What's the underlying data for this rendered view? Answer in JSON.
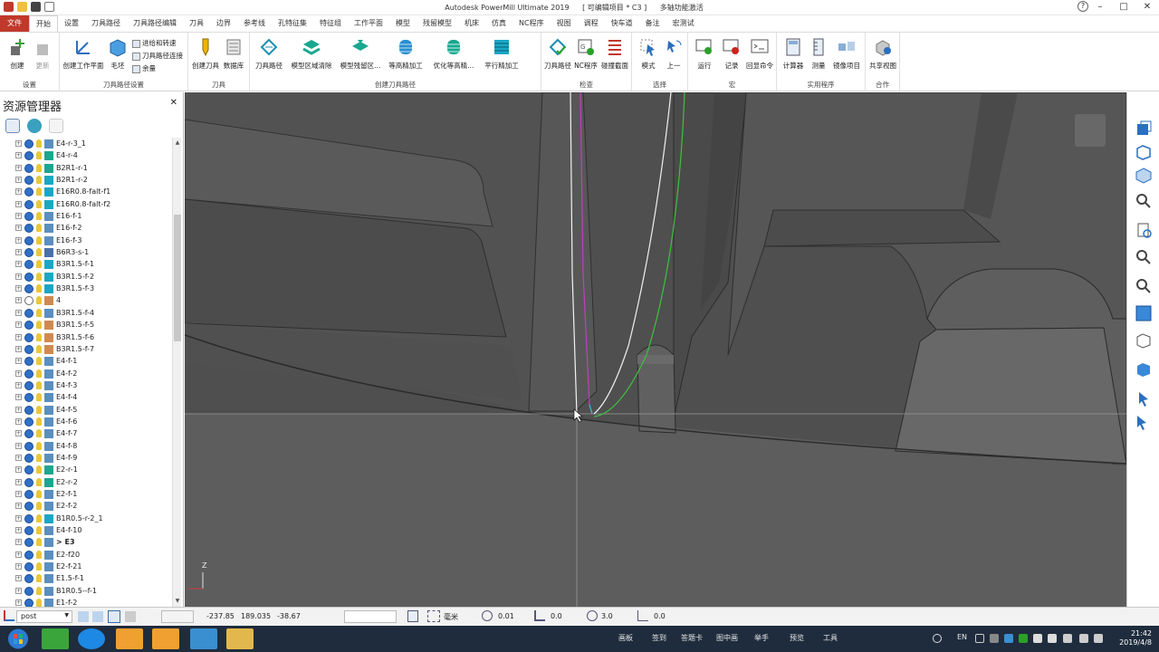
{
  "window": {
    "title": "Autodesk PowerMill Ultimate 2019",
    "project": "[ 可编辑项目 * C3 ]",
    "mode": "多轴功能激活"
  },
  "tabs": [
    "文件",
    "开始",
    "设置",
    "刀具路径",
    "刀具路径编辑",
    "刀具",
    "边界",
    "参考线",
    "孔特征集",
    "特征组",
    "工作平面",
    "模型",
    "残留模型",
    "机床",
    "仿真",
    "NC程序",
    "视图",
    "调程",
    "快车道",
    "备注",
    "宏测试"
  ],
  "ribbon": {
    "groups": {
      "setup": {
        "label": "设置",
        "buttons": [
          "创建",
          "更新"
        ]
      },
      "toolpath_setup": {
        "label": "刀具路径设置",
        "buttons": [
          "创建工作平面",
          "毛坯"
        ],
        "small": [
          "进给和转速",
          "刀具路径连接",
          "余量"
        ]
      },
      "tool": {
        "label": "刀具",
        "buttons": [
          "创建刀具",
          "数据库"
        ]
      },
      "create_toolpaths": {
        "label": "创建刀具路径",
        "buttons": [
          "刀具路径",
          "模型区域清除",
          "模型残留区...",
          "等高精加工",
          "优化等高精...",
          "平行精加工"
        ]
      },
      "verify": {
        "label": "检查",
        "buttons": [
          "刀具路径",
          "NC程序",
          "碰撞截面"
        ]
      },
      "select": {
        "label": "选择",
        "buttons": [
          "模式",
          "上一"
        ]
      },
      "macro": {
        "label": "宏",
        "buttons": [
          "运行",
          "记录",
          "回显命令"
        ]
      },
      "utilities": {
        "label": "实用程序",
        "buttons": [
          "计算器",
          "测量",
          "镜像项目"
        ]
      },
      "collab": {
        "label": "合作",
        "buttons": [
          "共享视图"
        ]
      }
    }
  },
  "explorer": {
    "title": "资源管理器",
    "items": [
      {
        "label": "E4-r-3_1",
        "checked": true,
        "icon": "parallel"
      },
      {
        "label": "E4-r-4",
        "checked": true,
        "icon": "clearance"
      },
      {
        "label": "B2R1-r-1",
        "checked": true,
        "icon": "clearance"
      },
      {
        "label": "B2R1-r-2",
        "checked": true,
        "icon": "waterline"
      },
      {
        "label": "E16R0.8-falt-f1",
        "checked": true,
        "icon": "waterline"
      },
      {
        "label": "E16R0.8-falt-f2",
        "checked": true,
        "icon": "waterline"
      },
      {
        "label": "E16-f-1",
        "checked": true,
        "icon": "parallel"
      },
      {
        "label": "E16-f-2",
        "checked": true,
        "icon": "parallel"
      },
      {
        "label": "E16-f-3",
        "checked": true,
        "icon": "parallel"
      },
      {
        "label": "B6R3-s-1",
        "checked": true,
        "icon": "swarf"
      },
      {
        "label": "B3R1.5-f-1",
        "checked": true,
        "icon": "waterline"
      },
      {
        "label": "B3R1.5-f-2",
        "checked": true,
        "icon": "waterline"
      },
      {
        "label": "B3R1.5-f-3",
        "checked": true,
        "icon": "waterline"
      },
      {
        "label": "4",
        "checked": false,
        "icon": "other"
      },
      {
        "label": "B3R1.5-f-4",
        "checked": true,
        "icon": "parallel"
      },
      {
        "label": "B3R1.5-f-5",
        "checked": true,
        "icon": "other"
      },
      {
        "label": "B3R1.5-f-6",
        "checked": true,
        "icon": "other"
      },
      {
        "label": "B3R1.5-f-7",
        "checked": true,
        "icon": "other"
      },
      {
        "label": "E4-f-1",
        "checked": true,
        "icon": "parallel"
      },
      {
        "label": "E4-f-2",
        "checked": true,
        "icon": "parallel"
      },
      {
        "label": "E4-f-3",
        "checked": true,
        "icon": "parallel"
      },
      {
        "label": "E4-f-4",
        "checked": true,
        "icon": "parallel"
      },
      {
        "label": "E4-f-5",
        "checked": true,
        "icon": "parallel"
      },
      {
        "label": "E4-f-6",
        "checked": true,
        "icon": "parallel"
      },
      {
        "label": "E4-f-7",
        "checked": true,
        "icon": "parallel"
      },
      {
        "label": "E4-f-8",
        "checked": true,
        "icon": "parallel"
      },
      {
        "label": "E4-f-9",
        "checked": true,
        "icon": "parallel"
      },
      {
        "label": "E2-r-1",
        "checked": true,
        "icon": "clearance"
      },
      {
        "label": "E2-r-2",
        "checked": true,
        "icon": "clearance"
      },
      {
        "label": "E2-f-1",
        "checked": true,
        "icon": "parallel"
      },
      {
        "label": "E2-f-2",
        "checked": true,
        "icon": "parallel"
      },
      {
        "label": "B1R0.5-r-2_1",
        "checked": true,
        "icon": "waterline"
      },
      {
        "label": "E4-f-10",
        "checked": true,
        "icon": "parallel"
      },
      {
        "label": "> E3",
        "checked": true,
        "icon": "parallel",
        "bold": true
      },
      {
        "label": "E2-f20",
        "checked": true,
        "icon": "parallel"
      },
      {
        "label": "E2-f-21",
        "checked": true,
        "icon": "parallel"
      },
      {
        "label": "E1.5-f-1",
        "checked": true,
        "icon": "parallel"
      },
      {
        "label": "B1R0.5--f-1",
        "checked": true,
        "icon": "parallel"
      },
      {
        "label": "E1-f-2",
        "checked": true,
        "icon": "parallel"
      }
    ]
  },
  "viewport": {
    "axis_label": "Z"
  },
  "status": {
    "workplane": "post",
    "x": "-237.85",
    "y": "189.035",
    "z": "-38.67",
    "units": "毫米",
    "tolerance": "0.01",
    "thickness": "0.0",
    "diameter": "3.0",
    "angle": "0.0"
  },
  "taskbar": {
    "words": [
      "画板",
      "签到",
      "答题卡",
      "图中画",
      "举手",
      "预览",
      "工具"
    ],
    "lang": "EN",
    "time": "21:42",
    "date": "2019/4/8"
  },
  "colors": {
    "accent": "#c0392b",
    "viewport_bg": "#555555",
    "toolpath_magenta": "#c040c0",
    "toolpath_green": "#40c040",
    "toolpath_white": "#f0f0f0"
  }
}
